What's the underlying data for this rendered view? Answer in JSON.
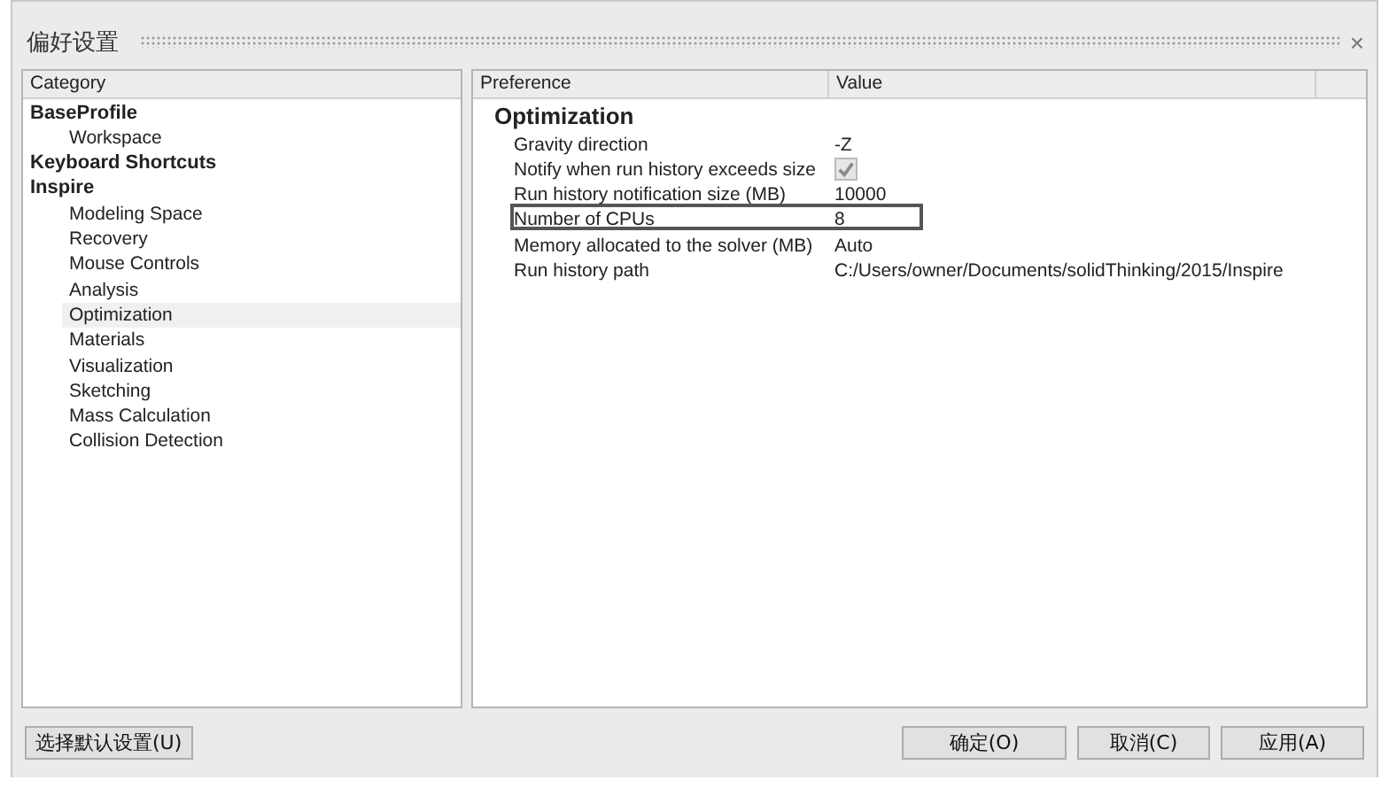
{
  "window": {
    "title": "偏好设置",
    "close": "×"
  },
  "category_panel": {
    "header": "Category",
    "items": [
      {
        "label": "BaseProfile",
        "selected": false,
        "children": [
          {
            "label": "Workspace",
            "selected": false
          }
        ]
      },
      {
        "label": "Keyboard Shortcuts",
        "selected": false
      },
      {
        "label": "Inspire",
        "selected": false,
        "children": [
          {
            "label": "Modeling Space",
            "selected": false
          },
          {
            "label": "Recovery",
            "selected": false
          },
          {
            "label": "Mouse Controls",
            "selected": false
          },
          {
            "label": "Analysis",
            "selected": false
          },
          {
            "label": "Optimization",
            "selected": true
          },
          {
            "label": "Materials",
            "selected": false
          },
          {
            "label": "Visualization",
            "selected": false
          },
          {
            "label": "Sketching",
            "selected": false
          },
          {
            "label": "Mass Calculation",
            "selected": false
          },
          {
            "label": "Collision Detection",
            "selected": false
          }
        ]
      }
    ]
  },
  "preference_panel": {
    "columns": [
      "Preference",
      "Value"
    ],
    "section": "Optimization",
    "rows": [
      {
        "kind": "text",
        "name": "Gravity direction",
        "value": "-Z",
        "selected": false
      },
      {
        "kind": "checkbox",
        "name": "Notify when run history exceeds size",
        "checked": true,
        "disabled": true,
        "selected": false
      },
      {
        "kind": "text",
        "name": "Run history notification size (MB)",
        "value": "10000",
        "selected": false
      },
      {
        "kind": "text",
        "name": "Number of CPUs",
        "value": "8",
        "selected": true
      },
      {
        "kind": "text",
        "name": "Memory allocated to the solver (MB)",
        "value": "Auto",
        "selected": false
      },
      {
        "kind": "text",
        "name": "Run history path",
        "value": "C:/Users/owner/Documents/solidThinking/2015/Inspire",
        "selected": false
      }
    ]
  },
  "buttons": {
    "left": "选择默认设置(U)",
    "right": [
      "确定(O)",
      "取消(C)",
      "应用(A)"
    ]
  }
}
